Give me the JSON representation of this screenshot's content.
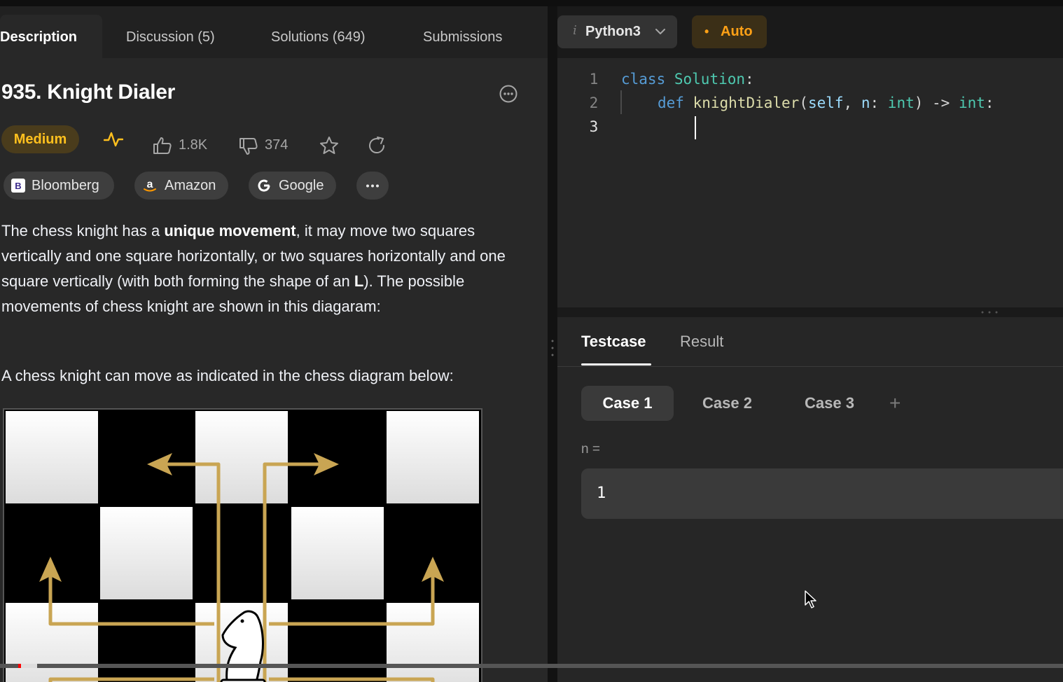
{
  "left_tabs": [
    {
      "label": "Description"
    },
    {
      "label": "Discussion (5)"
    },
    {
      "label": "Solutions (649)"
    },
    {
      "label": "Submissions"
    }
  ],
  "problem": {
    "title": "935. Knight Dialer",
    "difficulty": "Medium",
    "likes": "1.8K",
    "dislikes": "374"
  },
  "companies": [
    {
      "label": "Bloomberg",
      "icon": "bloomberg-logo"
    },
    {
      "label": "Amazon",
      "icon": "amazon-logo"
    },
    {
      "label": "Google",
      "icon": "google-logo"
    }
  ],
  "description": {
    "p1_a": "The chess knight has a ",
    "p1_b": "unique movement",
    "p1_c": ", it may move two squares vertically and one square horizontally, or two squares horizontally and one square vertically (with both forming the shape of an ",
    "p1_d": "L",
    "p1_e": "). The possible movements of chess knight are shown in this diagaram:",
    "p2": "A chess knight can move as indicated in the chess diagram below:"
  },
  "editor": {
    "language": "Python3",
    "mode": "Auto",
    "line_numbers": [
      "1",
      "2",
      "3"
    ],
    "line1": {
      "kw": "class",
      "name": "Solution",
      "punct": ":"
    },
    "line2": {
      "kw": "def",
      "fn": "knightDialer",
      "open": "(",
      "self": "self",
      "sep": ", ",
      "param": "n",
      "colon": ": ",
      "type1": "int",
      "close": ") -> ",
      "type2": "int",
      "end": ":"
    }
  },
  "bottom": {
    "tabs": [
      {
        "label": "Testcase"
      },
      {
        "label": "Result"
      }
    ],
    "cases": [
      {
        "label": "Case 1"
      },
      {
        "label": "Case 2"
      },
      {
        "label": "Case 3"
      }
    ],
    "add": "+",
    "param_label": "n =",
    "param_value": "1"
  },
  "video": {
    "progress": 0.004
  },
  "colors": {
    "accent_gold": "#c9a553",
    "difficulty": "#ffc01e",
    "auto": "#ffa116"
  }
}
